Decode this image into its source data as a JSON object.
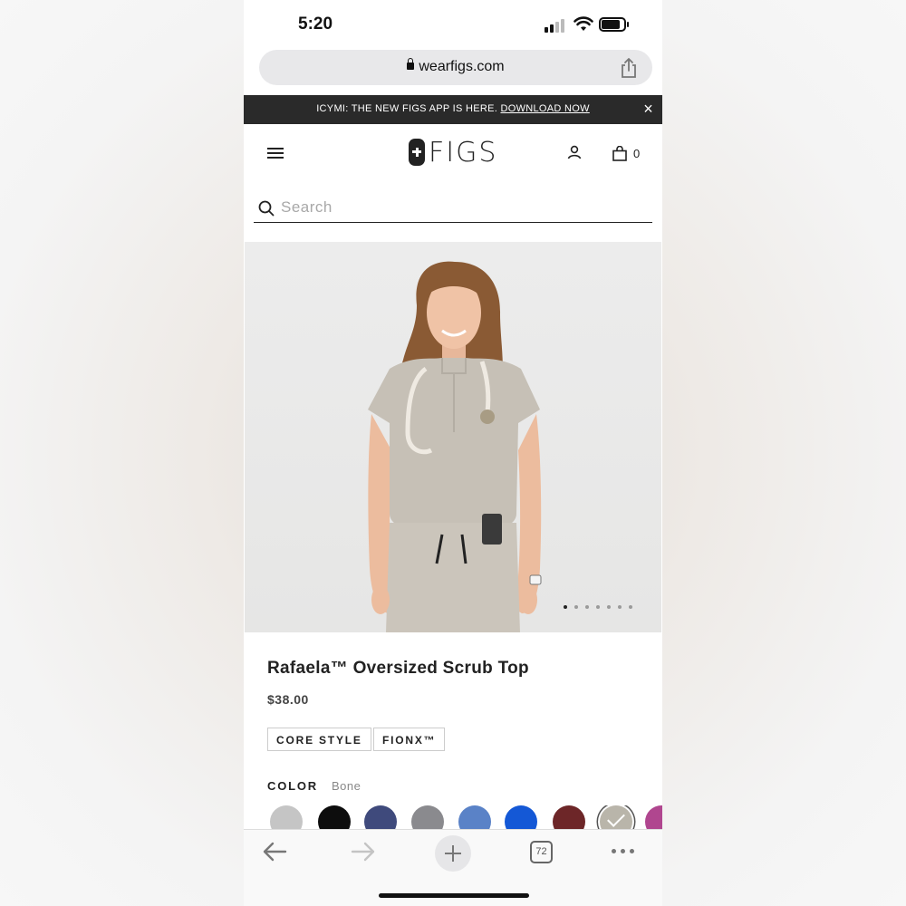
{
  "status_bar": {
    "time": "5:20"
  },
  "browser": {
    "url": "wearfigs.com",
    "tabs_count": "72"
  },
  "banner": {
    "text": "ICYMI: THE NEW FIGS APP IS HERE.",
    "link": "DOWNLOAD NOW",
    "close": "×"
  },
  "header": {
    "logo": "FIGS",
    "cart_count": "0"
  },
  "search": {
    "placeholder": "Search"
  },
  "gallery": {
    "image_count": 7,
    "active_index": 0
  },
  "product": {
    "title": "Rafaela™ Oversized Scrub Top",
    "price": "$38.00",
    "tags": [
      "CORE STYLE",
      "FIONX™"
    ],
    "color_label": "COLOR",
    "color_selected": "Bone",
    "swatch_colors": [
      "#c5c5c5",
      "#0d0d0d",
      "#3f4a7c",
      "#8a8a8e",
      "#5a82c7",
      "#1458d6",
      "#6d2628",
      "#b9b5aa",
      "#b0468f"
    ],
    "selected_swatch_index": 7
  },
  "colors": {
    "banner_bg": "#2a2a2a",
    "text": "#222222"
  }
}
